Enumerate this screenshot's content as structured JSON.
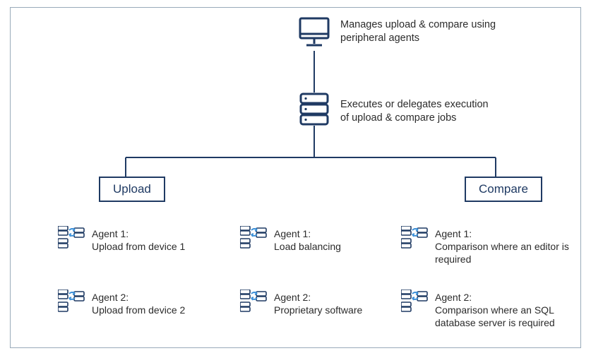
{
  "top": {
    "monitor_caption_line1": "Manages upload & compare using",
    "monitor_caption_line2": "peripheral agents",
    "server_caption_line1": "Executes or delegates execution",
    "server_caption_line2": "of upload & compare jobs"
  },
  "branches": {
    "left_label": "Upload",
    "right_label": "Compare"
  },
  "agents": {
    "col1_row1_line1": "Agent 1:",
    "col1_row1_line2": "Upload from device 1",
    "col1_row2_line1": "Agent 2:",
    "col1_row2_line2": "Upload from device 2",
    "col2_row1_line1": "Agent 1:",
    "col2_row1_line2": "Load balancing",
    "col2_row2_line1": "Agent 2:",
    "col2_row2_line2": "Proprietary software",
    "col3_row1_line1": "Agent 1:",
    "col3_row1_line2": "Comparison where an editor is",
    "col3_row1_line3": "required",
    "col3_row2_line1": "Agent 2:",
    "col3_row2_line2": "Comparison where an SQL",
    "col3_row2_line3": "database server is required"
  },
  "icon_names": {
    "monitor": "monitor-icon",
    "server": "server-stack-icon",
    "agent_pair": "agent-exchange-icon"
  }
}
